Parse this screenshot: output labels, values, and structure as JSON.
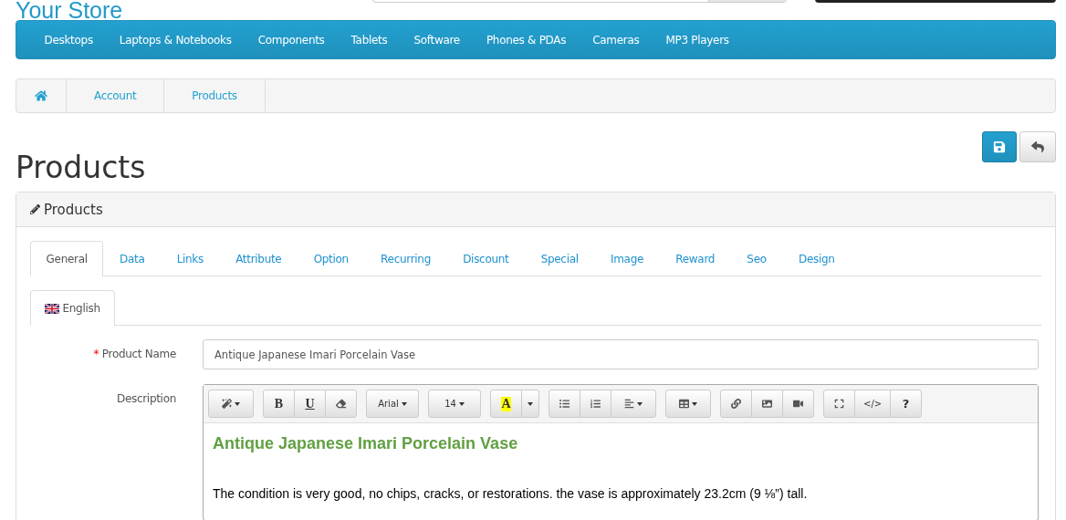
{
  "header": {
    "logo": "Your Store"
  },
  "menu": [
    "Desktops",
    "Laptops & Notebooks",
    "Components",
    "Tablets",
    "Software",
    "Phones & PDAs",
    "Cameras",
    "MP3 Players"
  ],
  "breadcrumb": [
    "Account",
    "Products"
  ],
  "page_title": "Products",
  "panel": {
    "title": "Products",
    "tabs": [
      {
        "label": "General",
        "selected": true
      },
      {
        "label": "Data",
        "selected": false
      },
      {
        "label": "Links",
        "selected": false
      },
      {
        "label": "Attribute",
        "selected": false
      },
      {
        "label": "Option",
        "selected": false
      },
      {
        "label": "Recurring",
        "selected": false
      },
      {
        "label": "Discount",
        "selected": false
      },
      {
        "label": "Special",
        "selected": false
      },
      {
        "label": "Image",
        "selected": false
      },
      {
        "label": "Reward",
        "selected": false
      },
      {
        "label": "Seo",
        "selected": false
      },
      {
        "label": "Design",
        "selected": false
      }
    ],
    "language_tabs": [
      {
        "label": "English",
        "selected": true
      }
    ],
    "product_name": {
      "label": "Product Name",
      "required_mark": "*",
      "value": "Antique Japanese Imari Porcelain Vase"
    },
    "description": {
      "label": "Description",
      "toolbar": [
        [
          {
            "kind": "magic"
          }
        ],
        [
          {
            "kind": "bold",
            "label": "B"
          },
          {
            "kind": "underline",
            "label": "U"
          },
          {
            "kind": "eraser"
          }
        ],
        [
          {
            "kind": "dropdown",
            "label": "Arial"
          }
        ],
        [
          {
            "kind": "dropdown",
            "label": "14"
          }
        ],
        [
          {
            "kind": "highlight",
            "label": "A"
          },
          {
            "kind": "caret"
          }
        ],
        [
          {
            "kind": "bullets"
          },
          {
            "kind": "numbers"
          },
          {
            "kind": "align"
          }
        ],
        [
          {
            "kind": "table"
          }
        ],
        [
          {
            "kind": "link"
          },
          {
            "kind": "picture"
          },
          {
            "kind": "video"
          }
        ],
        [
          {
            "kind": "fullscreen"
          },
          {
            "kind": "code",
            "label": "</>"
          },
          {
            "kind": "help",
            "label": "?"
          }
        ]
      ],
      "heading": "Antique Japanese Imari Porcelain Vase",
      "paragraph": "The condition is very good, no chips, cracks, or restorations. the vase is approximately 23.2cm (9 ⅛”) tall."
    }
  }
}
